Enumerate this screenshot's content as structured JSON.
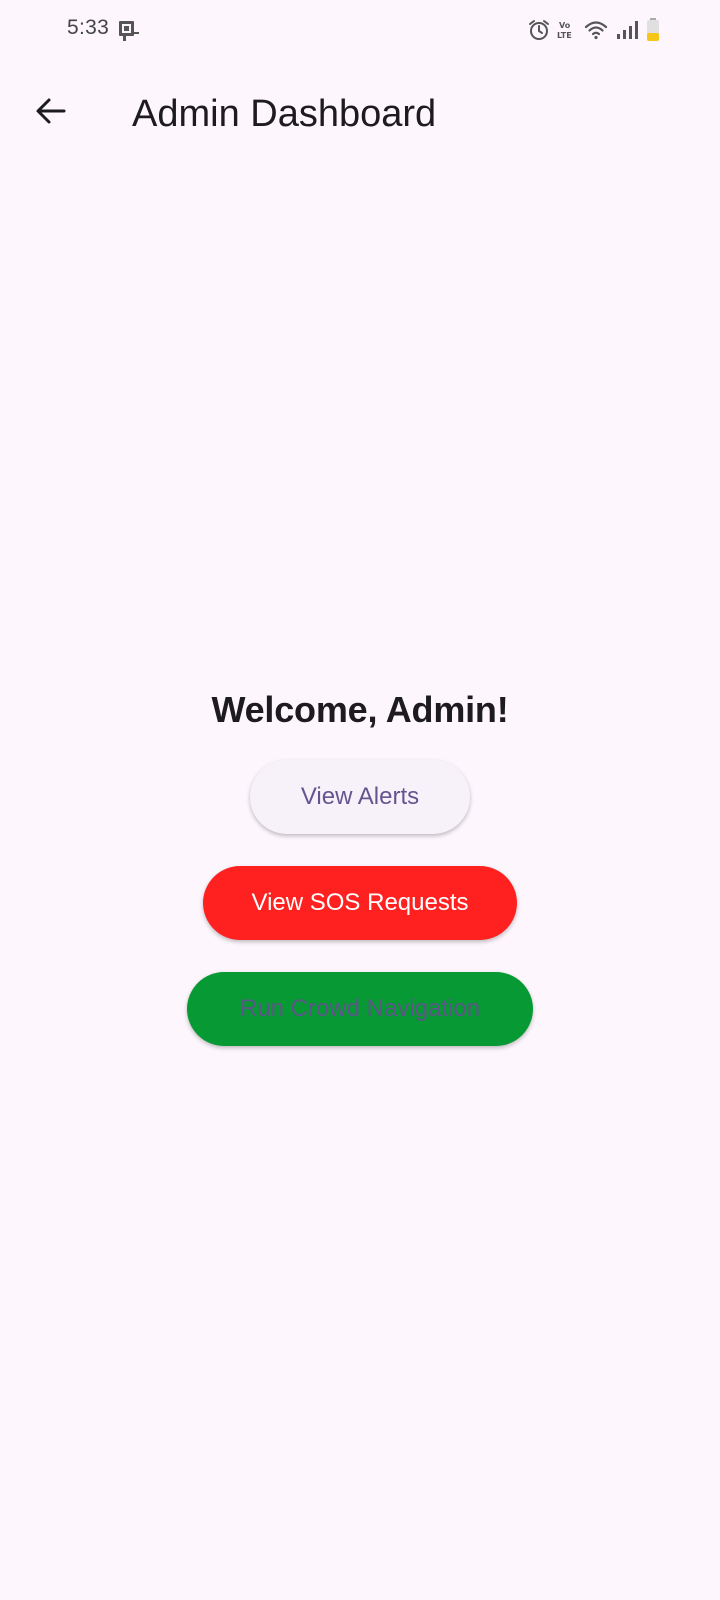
{
  "status_bar": {
    "time": "5:33",
    "volte_label": "Vo))\nLTE",
    "icons": [
      "notification-icon",
      "alarm-icon",
      "volte-icon",
      "wifi-icon",
      "signal-icon",
      "battery-icon"
    ],
    "battery_color": "#f5c518"
  },
  "app_bar": {
    "back_icon": "arrow-back-icon",
    "title": "Admin Dashboard"
  },
  "main": {
    "welcome": "Welcome, Admin!",
    "buttons": {
      "view_alerts": "View Alerts",
      "view_sos": "View SOS Requests",
      "run_crowd": "Run Crowd Navigation"
    }
  },
  "colors": {
    "background": "#fdf7fd",
    "alerts_button": "#f7f2fa",
    "alerts_text": "#65558f",
    "sos_button": "#ff2020",
    "crowd_button": "#079933"
  }
}
